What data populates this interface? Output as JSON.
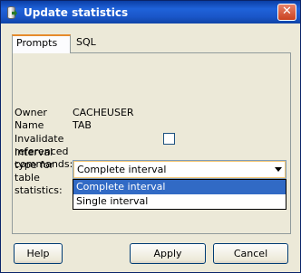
{
  "window": {
    "title": "Update statistics",
    "close_glyph": "✕"
  },
  "tabs": [
    {
      "label": "Prompts",
      "active": true
    },
    {
      "label": "SQL",
      "active": false
    }
  ],
  "fields": {
    "owner_label": "Owner",
    "owner_value": "CACHEUSER",
    "name_label": "Name",
    "name_value": "TAB",
    "invalidate_label": "Invalidate referenced commands:",
    "invalidate_checked": false,
    "interval_label": "Interval type for table statistics:"
  },
  "interval_select": {
    "selected": "Complete interval",
    "options": [
      "Complete interval",
      "Single interval"
    ]
  },
  "buttons": {
    "help": "Help",
    "apply": "Apply",
    "cancel": "Cancel"
  },
  "colors": {
    "titlebar": "#1f62d9",
    "selection": "#316ac5",
    "active_tab_accent": "#e68b2c"
  }
}
